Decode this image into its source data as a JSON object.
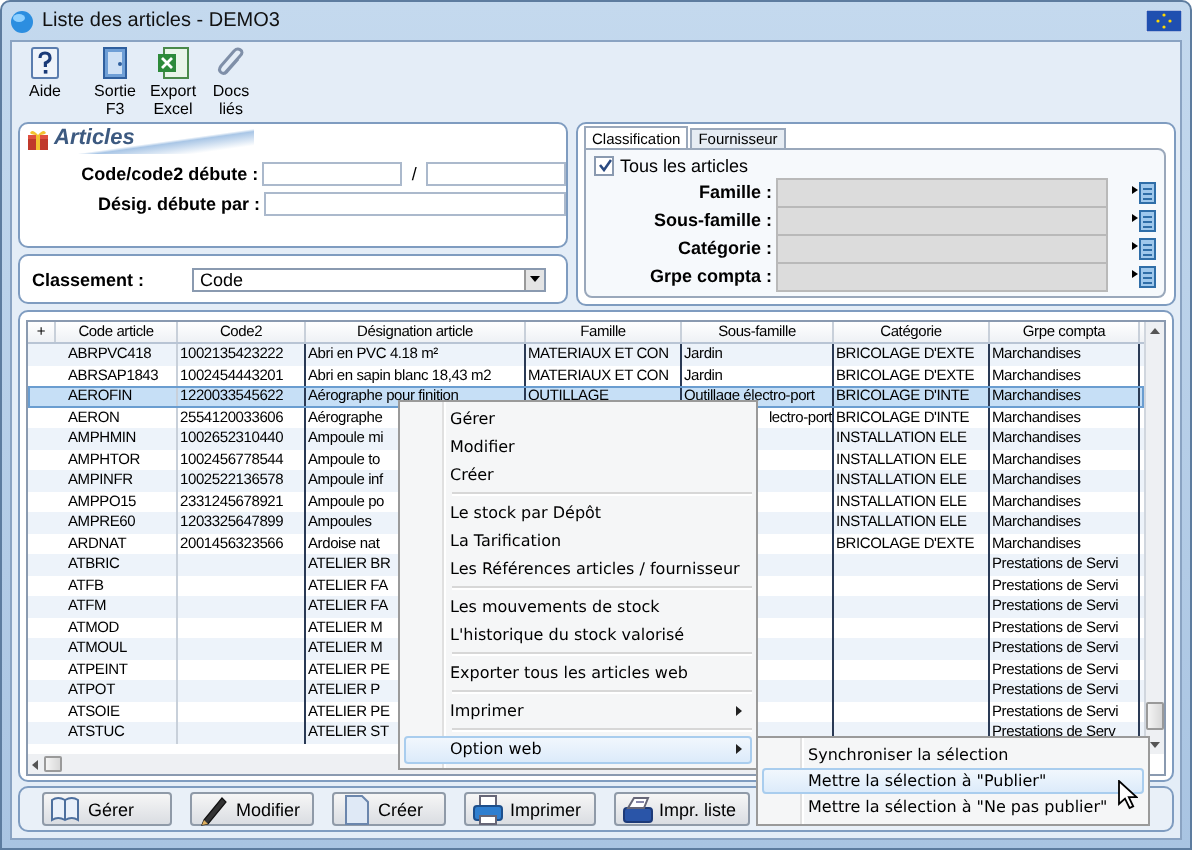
{
  "window": {
    "title": "Liste des articles - DEMO3"
  },
  "toolbar": [
    {
      "label": "Aide",
      "kind": "help"
    },
    {
      "label": "Sortie F3",
      "kind": "exit"
    },
    {
      "label": "Export Excel",
      "kind": "excel"
    },
    {
      "label": "Docs liés",
      "kind": "clip"
    }
  ],
  "articles_panel": {
    "title": "Articles",
    "fields": [
      {
        "label": "Code/code2 débute :",
        "separator": "/"
      },
      {
        "label": "Désig. débute par :"
      }
    ]
  },
  "classement": {
    "label": "Classement :",
    "value": "Code"
  },
  "criteria": {
    "tabs": [
      {
        "label": "Classification",
        "selected": true
      },
      {
        "label": "Fournisseur",
        "selected": false
      }
    ],
    "all_articles": {
      "label": "Tous les articles",
      "checked": true
    },
    "fields": [
      {
        "label": "Famille :",
        "disabled": true
      },
      {
        "label": "Sous-famille :",
        "disabled": true
      },
      {
        "label": "Catégorie :",
        "disabled": true
      },
      {
        "label": "Grpe compta :",
        "disabled": true
      }
    ]
  },
  "grid": {
    "corner": "+",
    "columns": [
      "Code article",
      "Code2",
      "Désignation article",
      "Famille",
      "Sous-famille",
      "Catégorie",
      "Grpe compta"
    ],
    "rows": [
      {
        "selected": false,
        "cells": [
          "ABRPVC418",
          "1002135423222",
          "Abri en PVC 4.18 m²",
          "MATERIAUX ET CON",
          "Jardin",
          "BRICOLAGE D'EXTE",
          "Marchandises"
        ]
      },
      {
        "selected": false,
        "cells": [
          "ABRSAP1843",
          "1002454443201",
          "Abri en sapin blanc 18,43 m2",
          "MATERIAUX ET CON",
          "Jardin",
          "BRICOLAGE D'EXTE",
          "Marchandises"
        ]
      },
      {
        "selected": true,
        "cells": [
          "AEROFIN",
          "1220033545622",
          "Aérographe pour finition",
          "OUTILLAGE",
          "Outillage électro-port",
          "BRICOLAGE D'INTE",
          "Marchandises"
        ]
      },
      {
        "selected": false,
        "cells": [
          "AERON",
          "2554120033606",
          "Aérographe",
          null,
          "lectro-port",
          "BRICOLAGE D'INTE",
          "Marchandises"
        ]
      },
      {
        "selected": false,
        "cells": [
          "AMPHMIN",
          "1002652310440",
          "Ampoule mi",
          null,
          null,
          "INSTALLATION ELE",
          "Marchandises"
        ]
      },
      {
        "selected": false,
        "cells": [
          "AMPHTOR",
          "1002456778544",
          "Ampoule to",
          null,
          null,
          "INSTALLATION ELE",
          "Marchandises"
        ]
      },
      {
        "selected": false,
        "cells": [
          "AMPINFR",
          "1002522136578",
          "Ampoule inf",
          null,
          null,
          "INSTALLATION ELE",
          "Marchandises"
        ]
      },
      {
        "selected": false,
        "cells": [
          "AMPPO15",
          "2331245678921",
          "Ampoule po",
          null,
          null,
          "INSTALLATION ELE",
          "Marchandises"
        ]
      },
      {
        "selected": false,
        "cells": [
          "AMPRE60",
          "1203325647899",
          "Ampoules",
          null,
          null,
          "INSTALLATION ELE",
          "Marchandises"
        ]
      },
      {
        "selected": false,
        "cells": [
          "ARDNAT",
          "2001456323566",
          "Ardoise nat",
          null,
          null,
          "BRICOLAGE D'EXTE",
          "Marchandises"
        ]
      },
      {
        "selected": false,
        "cells": [
          "ATBRIC",
          null,
          "ATELIER BR",
          null,
          null,
          null,
          "Prestations de Servi"
        ]
      },
      {
        "selected": false,
        "cells": [
          "ATFB",
          null,
          "ATELIER FA",
          null,
          null,
          null,
          "Prestations de Servi"
        ]
      },
      {
        "selected": false,
        "cells": [
          "ATFM",
          null,
          "ATELIER FA",
          null,
          null,
          null,
          "Prestations de Servi"
        ]
      },
      {
        "selected": false,
        "cells": [
          "ATMOD",
          null,
          "ATELIER M",
          null,
          null,
          null,
          "Prestations de Servi"
        ]
      },
      {
        "selected": false,
        "cells": [
          "ATMOUL",
          null,
          "ATELIER M",
          null,
          null,
          null,
          "Prestations de Servi"
        ]
      },
      {
        "selected": false,
        "cells": [
          "ATPEINT",
          null,
          "ATELIER PE",
          null,
          null,
          null,
          "Prestations de Servi"
        ]
      },
      {
        "selected": false,
        "cells": [
          "ATPOT",
          null,
          "ATELIER P",
          null,
          null,
          null,
          "Prestations de Servi"
        ]
      },
      {
        "selected": false,
        "cells": [
          "ATSOIE",
          null,
          "ATELIER PE",
          null,
          null,
          null,
          "Prestations de Servi"
        ]
      },
      {
        "selected": false,
        "cells": [
          "ATSTUC",
          null,
          "ATELIER ST",
          null,
          null,
          null,
          "Prestations de Serv"
        ]
      }
    ]
  },
  "context_menu": {
    "items": [
      {
        "kind": "item",
        "label": "Gérer",
        "highlighted": false
      },
      {
        "kind": "item",
        "label": "Modifier",
        "highlighted": false
      },
      {
        "kind": "item",
        "label": "Créer",
        "highlighted": false
      },
      {
        "kind": "separator"
      },
      {
        "kind": "item",
        "label": "Le stock par Dépôt",
        "highlighted": false
      },
      {
        "kind": "item",
        "label": "La Tarification",
        "highlighted": false
      },
      {
        "kind": "item",
        "label": "Les Références articles / fournisseur",
        "highlighted": false
      },
      {
        "kind": "separator"
      },
      {
        "kind": "item",
        "label": "Les mouvements de stock",
        "highlighted": false
      },
      {
        "kind": "item",
        "label": "L'historique du stock valorisé",
        "highlighted": false
      },
      {
        "kind": "separator"
      },
      {
        "kind": "item",
        "label": "Exporter tous les articles web",
        "highlighted": false
      },
      {
        "kind": "separator"
      },
      {
        "kind": "submenu",
        "label": "Imprimer",
        "highlighted": false
      },
      {
        "kind": "separator"
      },
      {
        "kind": "submenu",
        "label": "Option web",
        "highlighted": true
      }
    ],
    "submenu": [
      {
        "kind": "item",
        "label": "Synchroniser la sélection",
        "highlighted": false
      },
      {
        "kind": "item",
        "label": "Mettre la sélection à \"Publier\"",
        "highlighted": true
      },
      {
        "kind": "item",
        "label": "Mettre la sélection à \"Ne pas publier\"",
        "highlighted": false
      }
    ]
  },
  "buttons": [
    {
      "label": "Gérer",
      "kind": "book"
    },
    {
      "label": "Modifier",
      "kind": "pen"
    },
    {
      "label": "Créer",
      "kind": "page"
    },
    {
      "label": "Imprimer",
      "kind": "printer"
    },
    {
      "label": "Impr. liste",
      "kind": "printlist"
    }
  ]
}
